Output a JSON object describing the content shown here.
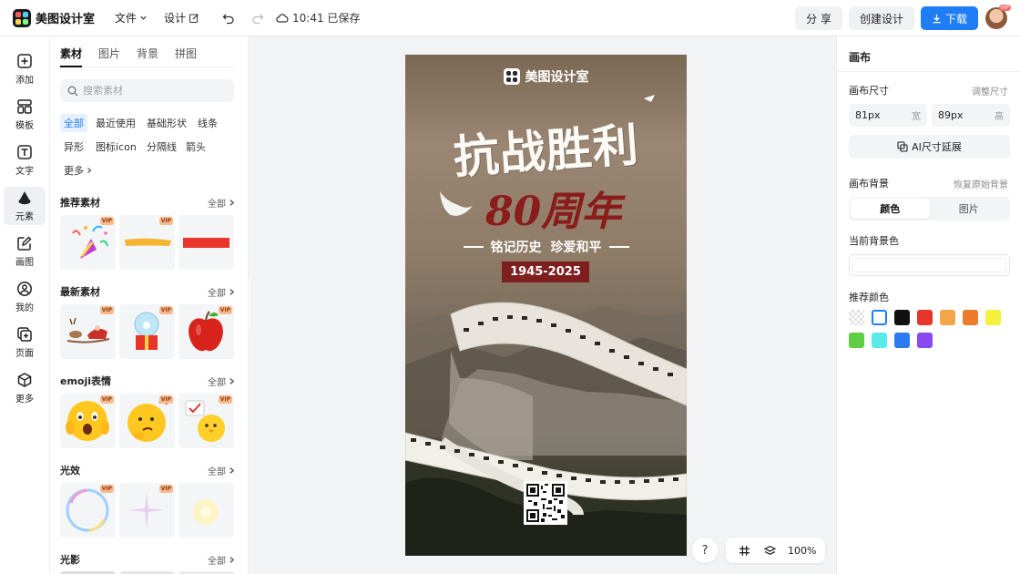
{
  "app": {
    "name": "美图设计室"
  },
  "colors": {
    "accent": "#1f7ef5",
    "poster_red": "#7e1e1e"
  },
  "menu": {
    "file": "文件",
    "design": "设计",
    "saved": "10:41 已保存"
  },
  "top_actions": {
    "share": "分 享",
    "create": "创建设计",
    "download": "下载"
  },
  "rail": [
    {
      "label": "添加",
      "icon": "plus-square-icon"
    },
    {
      "label": "模板",
      "icon": "template-icon"
    },
    {
      "label": "文字",
      "icon": "text-icon"
    },
    {
      "label": "元素",
      "icon": "shapes-icon"
    },
    {
      "label": "画图",
      "icon": "draw-icon"
    },
    {
      "label": "我的",
      "icon": "user-icon"
    },
    {
      "label": "页面",
      "icon": "page-add-icon"
    },
    {
      "label": "更多",
      "icon": "cube-icon"
    }
  ],
  "panel": {
    "tabs": [
      "素材",
      "图片",
      "背景",
      "拼图"
    ],
    "search_placeholder": "搜索素材",
    "chips": [
      "全部",
      "最近使用",
      "基础形状",
      "线条",
      "异形",
      "图标icon",
      "分隔线",
      "箭头",
      "更多"
    ],
    "all_label": "全部",
    "vip": "VIP",
    "sections": [
      {
        "title": "推荐素材",
        "items": [
          "party-popper",
          "yellow-brush-stroke",
          "red-banner"
        ]
      },
      {
        "title": "最新素材",
        "items": [
          "reindeer-sleigh",
          "snow-globe-gift",
          "red-apple"
        ]
      },
      {
        "title": "emoji表情",
        "items": [
          "shocked-emoji",
          "thinking-emoji",
          "chick-emoji"
        ]
      },
      {
        "title": "光效",
        "items": [
          "bubble-ring",
          "star-sparkle",
          "glow-spot"
        ]
      },
      {
        "title": "光影",
        "items": []
      }
    ]
  },
  "poster": {
    "brand": "美图设计室",
    "title": "抗战胜利",
    "anniversary": "80周年",
    "subtitle_left": "铭记历史",
    "subtitle_right": "珍爱和平",
    "years": "1945-2025"
  },
  "canvas_tools": {
    "help": "?",
    "zoom": "100%"
  },
  "right_panel": {
    "title": "画布",
    "size_label": "画布尺寸",
    "resize_link": "调整尺寸",
    "width_value": "81px",
    "width_unit": "宽",
    "height_value": "89px",
    "height_unit": "高",
    "ai_extend": "AI尺寸延展",
    "bg_label": "画布背景",
    "restore_link": "恢复原始背景",
    "seg_color": "颜色",
    "seg_image": "图片",
    "current_bg": "当前背景色",
    "recommended": "推荐颜色",
    "swatches": [
      "transparent",
      "#ffffff",
      "#111111",
      "#e8352a",
      "#f2a54b",
      "#ee7b2a",
      "#f5f03b",
      "#5fce45",
      "#5ce9ea",
      "#2a7af0",
      "#8a48f0"
    ]
  }
}
